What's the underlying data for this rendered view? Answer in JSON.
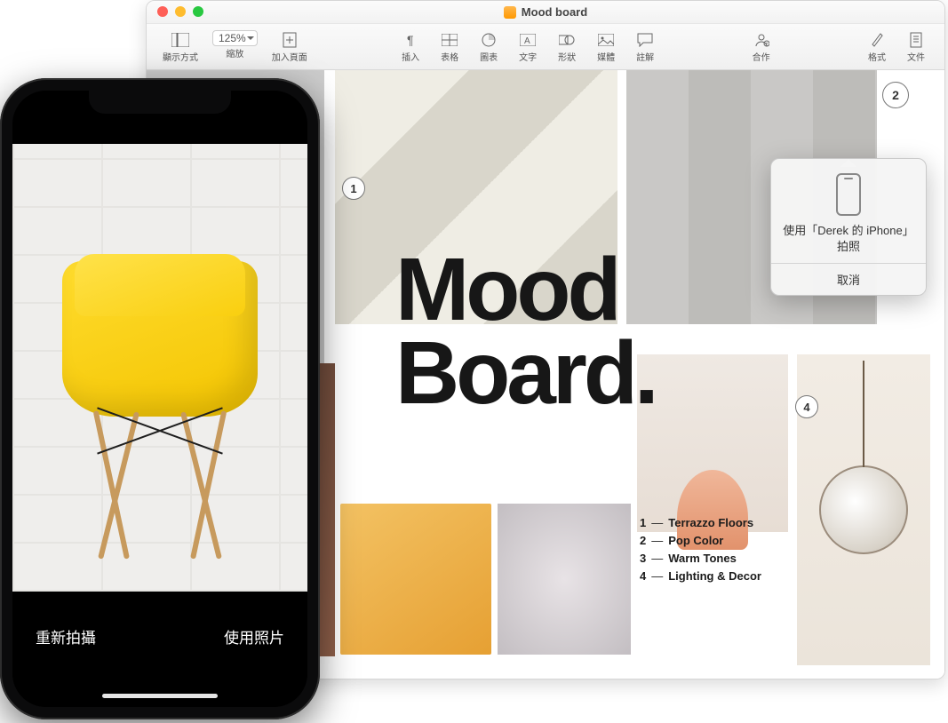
{
  "window": {
    "title": "Mood board"
  },
  "toolbar": {
    "view": "顯示方式",
    "zoom_value": "125%",
    "zoom_label": "縮放",
    "add_page": "加入頁面",
    "insert": "插入",
    "table": "表格",
    "chart": "圖表",
    "text": "文字",
    "shape": "形狀",
    "media": "媒體",
    "comment": "註解",
    "collaborate": "合作",
    "format": "格式",
    "document": "文件"
  },
  "doc": {
    "title_line1": "Mood",
    "title_line2": "Board.",
    "marker1": "1",
    "marker4": "4",
    "legend": [
      {
        "n": "1",
        "label": "Terrazzo Floors"
      },
      {
        "n": "2",
        "label": "Pop Color"
      },
      {
        "n": "3",
        "label": "Warm Tones"
      },
      {
        "n": "4",
        "label": "Lighting & Decor"
      }
    ]
  },
  "step_badge": "2",
  "popover": {
    "message": "使用「Derek 的 iPhone」拍照",
    "cancel": "取消"
  },
  "phone": {
    "retake": "重新拍攝",
    "use_photo": "使用照片"
  }
}
